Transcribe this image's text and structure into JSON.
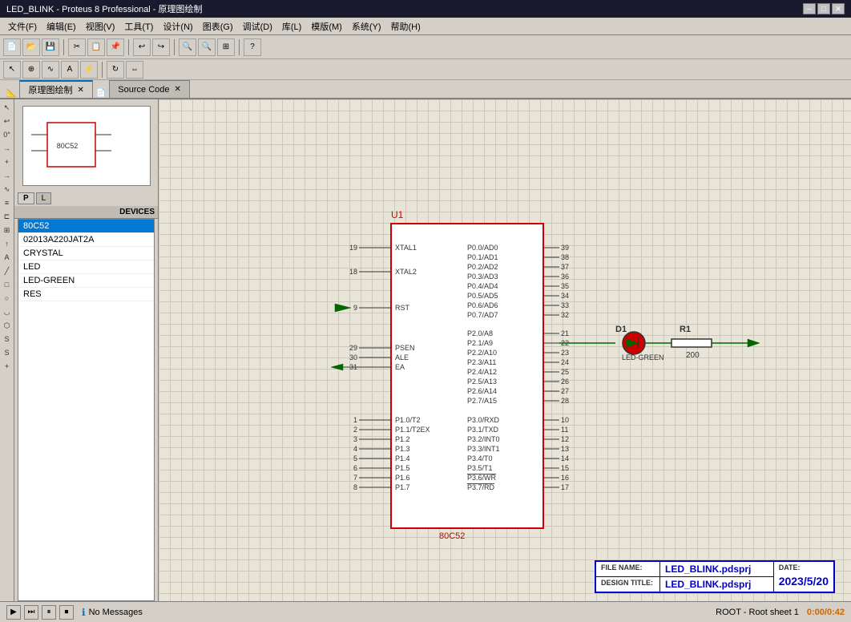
{
  "titleBar": {
    "title": "LED_BLINK - Proteus 8 Professional - 原理图绘制",
    "minBtn": "─",
    "maxBtn": "□",
    "closeBtn": "✕"
  },
  "menuBar": {
    "items": [
      "文件(F)",
      "编辑(E)",
      "视图(V)",
      "工具(T)",
      "设计(N)",
      "图表(G)",
      "调试(D)",
      "库(L)",
      "模版(M)",
      "系统(Y)",
      "帮助(H)"
    ]
  },
  "tabs": [
    {
      "id": "schematic",
      "label": "原理图绘制",
      "icon": "📐",
      "active": true
    },
    {
      "id": "sourcecode",
      "label": "Source Code",
      "icon": "📄",
      "active": false
    }
  ],
  "sidebar": {
    "tabP": "P",
    "tabL": "L",
    "groupLabel": "DEVICES",
    "devices": [
      {
        "name": "80C52",
        "selected": true
      },
      {
        "name": "02013A220JAT2A",
        "selected": false
      },
      {
        "name": "CRYSTAL",
        "selected": false
      },
      {
        "name": "LED",
        "selected": false
      },
      {
        "name": "LED-GREEN",
        "selected": false
      },
      {
        "name": "RES",
        "selected": false
      }
    ]
  },
  "schematic": {
    "ic": {
      "refLabel": "U1",
      "bottomLabel": "80C52",
      "leftPins": [
        {
          "num": "19",
          "name": "XTAL1"
        },
        {
          "num": "18",
          "name": "XTAL2"
        },
        {
          "num": "9",
          "name": "RST"
        },
        {
          "num": "29",
          "name": "PSEN"
        },
        {
          "num": "30",
          "name": "ALE"
        },
        {
          "num": "31",
          "name": "EA"
        },
        {
          "num": "1",
          "name": "P1.0/T2"
        },
        {
          "num": "2",
          "name": "P1.1/T2EX"
        },
        {
          "num": "3",
          "name": "P1.2"
        },
        {
          "num": "4",
          "name": "P1.3"
        },
        {
          "num": "5",
          "name": "P1.4"
        },
        {
          "num": "6",
          "name": "P1.5"
        },
        {
          "num": "7",
          "name": "P1.6"
        },
        {
          "num": "8",
          "name": "P1.7"
        }
      ],
      "rightPins": [
        {
          "num": "39",
          "name": "P0.0/AD0"
        },
        {
          "num": "38",
          "name": "P0.1/AD1"
        },
        {
          "num": "37",
          "name": "P0.2/AD2"
        },
        {
          "num": "36",
          "name": "P0.3/AD3"
        },
        {
          "num": "35",
          "name": "P0.4/AD4"
        },
        {
          "num": "34",
          "name": "P0.5/AD5"
        },
        {
          "num": "33",
          "name": "P0.6/AD6"
        },
        {
          "num": "32",
          "name": "P0.7/AD7"
        },
        {
          "num": "21",
          "name": "P2.0/A8"
        },
        {
          "num": "22",
          "name": "P2.1/A9"
        },
        {
          "num": "23",
          "name": "P2.2/A10"
        },
        {
          "num": "24",
          "name": "P2.3/A11"
        },
        {
          "num": "25",
          "name": "P2.4/A12"
        },
        {
          "num": "26",
          "name": "P2.5/A13"
        },
        {
          "num": "27",
          "name": "P2.6/A14"
        },
        {
          "num": "28",
          "name": "P2.7/A15"
        },
        {
          "num": "10",
          "name": "P3.0/RXD"
        },
        {
          "num": "11",
          "name": "P3.1/TXD"
        },
        {
          "num": "12",
          "name": "P3.2/INT0"
        },
        {
          "num": "13",
          "name": "P3.3/INT1"
        },
        {
          "num": "14",
          "name": "P3.4/T0"
        },
        {
          "num": "15",
          "name": "P3.5/T1"
        },
        {
          "num": "16",
          "name": "P3.6/WR"
        },
        {
          "num": "17",
          "name": "P3.7/RD"
        }
      ]
    },
    "led": {
      "refLabel": "D1",
      "typeLabel": "LED-GREEN"
    },
    "resistor": {
      "refLabel": "R1",
      "value": "200"
    }
  },
  "infoPanel": {
    "fileLabel": "FILE NAME:",
    "fileValue": "LED_BLINK.pdsprj",
    "designLabel": "DESIGN TITLE:",
    "designValue": "LED_BLINK.pdsprj",
    "dateLabel": "DATE:",
    "dateValue": "2023/5/20"
  },
  "statusBar": {
    "noMessages": "No Messages",
    "root": "ROOT - Root sheet 1",
    "time": "0:00/0:42"
  }
}
